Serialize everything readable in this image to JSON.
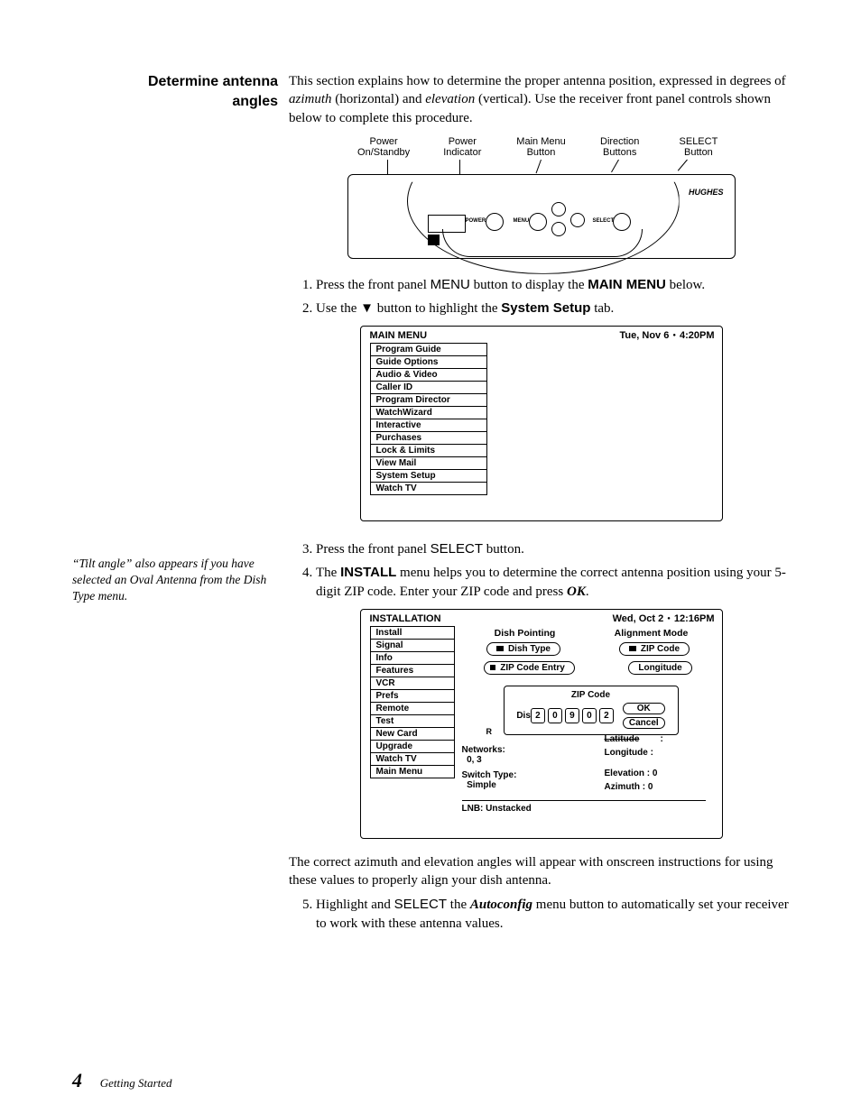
{
  "section_title_l1": "Determine antenna",
  "section_title_l2": "angles",
  "intro_1a": "This section explains how to determine the proper antenna position, expressed in degrees of ",
  "intro_1b_em": "azimuth",
  "intro_1c": " (horizontal) and ",
  "intro_1d_em": "elevation",
  "intro_1e": " (vertical). Use the receiver front panel controls shown below to complete this procedure.",
  "callouts": {
    "c1a": "Power",
    "c1b": "On/Standby",
    "c2a": "Power",
    "c2b": "Indicator",
    "c3a": "Main Menu",
    "c3b": "Button",
    "c4a": "Direction",
    "c4b": "Buttons",
    "c5a": "SELECT",
    "c5b": "Button"
  },
  "panel": {
    "power": "POWER",
    "menu": "MENU",
    "select": "SELECT",
    "brand": "HUGHES"
  },
  "step1_a": "Press the front panel ",
  "step1_b": "MENU",
  "step1_c": " button to display the ",
  "step1_d": "MAIN MENU",
  "step1_e": " below.",
  "step2_a": "Use the ",
  "step2_b": "▼",
  "step2_c": " button to highlight the ",
  "step2_d": "System Setup",
  "step2_e": " tab.",
  "mainmenu": {
    "title": "MAIN MENU",
    "date": "Tue, Nov 6",
    "time": "4:20PM",
    "items": [
      "Program Guide",
      "Guide Options",
      "Audio & Video",
      "Caller ID",
      "Program Director",
      "WatchWizard",
      "Interactive",
      "Purchases",
      "Lock & Limits",
      "View Mail",
      "System Setup",
      "Watch TV"
    ]
  },
  "step3_a": "Press the front panel ",
  "step3_b": "SELECT",
  "step3_c": " button.",
  "step4_a": "The ",
  "step4_b": "INSTALL",
  "step4_c": " menu helps you to determine the correct antenna position using your 5-digit ZIP code. Enter your ZIP code and press ",
  "step4_d": "OK",
  "step4_e": ".",
  "sidenote": "“Tilt angle” also appears if you have selected an Oval Antenna from the Dish Type menu.",
  "install": {
    "title": "INSTALLATION",
    "date": "Wed, Oct 2",
    "time": "12:16PM",
    "items": [
      "Install",
      "Signal",
      "Info",
      "Features",
      "VCR",
      "Prefs",
      "Remote",
      "Test",
      "New Card",
      "Upgrade",
      "Watch TV",
      "Main Menu"
    ],
    "hdr_dish": "Dish Pointing",
    "hdr_align": "Alignment Mode",
    "btn_dishtype": "Dish Type",
    "btn_zip": "ZIP Code",
    "btn_zipentry": "ZIP Code Entry",
    "btn_long": "Longitude",
    "popup_title": "ZIP Code",
    "popup_prefix": "Dis",
    "zip_d1": "2",
    "zip_d2": "0",
    "zip_d3": "9",
    "zip_d4": "0",
    "zip_d5": "2",
    "btn_ok": "OK",
    "btn_cancel": "Cancel",
    "networks_l": "Networks:",
    "networks_v": "0, 3",
    "switch_l": "Switch Type:",
    "switch_v": "Simple",
    "lnb": "LNB: Unstacked",
    "lat_l": "Latitude",
    "col": " :",
    "long_l": "Longitude :",
    "elev_l": "Elevation  : 0",
    "az_l": "Azimuth   : 0",
    "r_prefix": "R"
  },
  "outro": "The correct azimuth and elevation angles will appear with onscreen instructions for using these values to properly align your dish antenna.",
  "step5_a": "Highlight and ",
  "step5_b": "SELECT",
  "step5_c": " the ",
  "step5_d": "Autoconfig",
  "step5_e": " menu button to automatically set your receiver to work with these antenna values.",
  "footer_page": "4",
  "footer_title": "Getting Started"
}
